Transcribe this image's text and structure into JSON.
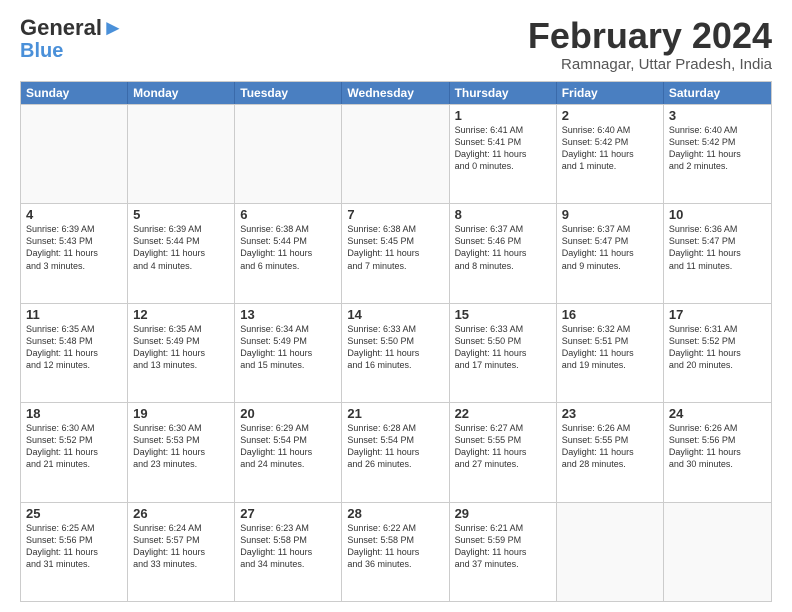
{
  "logo": {
    "line1": "General",
    "line2": "Blue"
  },
  "title": "February 2024",
  "subtitle": "Ramnagar, Uttar Pradesh, India",
  "days": [
    "Sunday",
    "Monday",
    "Tuesday",
    "Wednesday",
    "Thursday",
    "Friday",
    "Saturday"
  ],
  "rows": [
    [
      {
        "day": "",
        "info": ""
      },
      {
        "day": "",
        "info": ""
      },
      {
        "day": "",
        "info": ""
      },
      {
        "day": "",
        "info": ""
      },
      {
        "day": "1",
        "info": "Sunrise: 6:41 AM\nSunset: 5:41 PM\nDaylight: 11 hours\nand 0 minutes."
      },
      {
        "day": "2",
        "info": "Sunrise: 6:40 AM\nSunset: 5:42 PM\nDaylight: 11 hours\nand 1 minute."
      },
      {
        "day": "3",
        "info": "Sunrise: 6:40 AM\nSunset: 5:42 PM\nDaylight: 11 hours\nand 2 minutes."
      }
    ],
    [
      {
        "day": "4",
        "info": "Sunrise: 6:39 AM\nSunset: 5:43 PM\nDaylight: 11 hours\nand 3 minutes."
      },
      {
        "day": "5",
        "info": "Sunrise: 6:39 AM\nSunset: 5:44 PM\nDaylight: 11 hours\nand 4 minutes."
      },
      {
        "day": "6",
        "info": "Sunrise: 6:38 AM\nSunset: 5:44 PM\nDaylight: 11 hours\nand 6 minutes."
      },
      {
        "day": "7",
        "info": "Sunrise: 6:38 AM\nSunset: 5:45 PM\nDaylight: 11 hours\nand 7 minutes."
      },
      {
        "day": "8",
        "info": "Sunrise: 6:37 AM\nSunset: 5:46 PM\nDaylight: 11 hours\nand 8 minutes."
      },
      {
        "day": "9",
        "info": "Sunrise: 6:37 AM\nSunset: 5:47 PM\nDaylight: 11 hours\nand 9 minutes."
      },
      {
        "day": "10",
        "info": "Sunrise: 6:36 AM\nSunset: 5:47 PM\nDaylight: 11 hours\nand 11 minutes."
      }
    ],
    [
      {
        "day": "11",
        "info": "Sunrise: 6:35 AM\nSunset: 5:48 PM\nDaylight: 11 hours\nand 12 minutes."
      },
      {
        "day": "12",
        "info": "Sunrise: 6:35 AM\nSunset: 5:49 PM\nDaylight: 11 hours\nand 13 minutes."
      },
      {
        "day": "13",
        "info": "Sunrise: 6:34 AM\nSunset: 5:49 PM\nDaylight: 11 hours\nand 15 minutes."
      },
      {
        "day": "14",
        "info": "Sunrise: 6:33 AM\nSunset: 5:50 PM\nDaylight: 11 hours\nand 16 minutes."
      },
      {
        "day": "15",
        "info": "Sunrise: 6:33 AM\nSunset: 5:50 PM\nDaylight: 11 hours\nand 17 minutes."
      },
      {
        "day": "16",
        "info": "Sunrise: 6:32 AM\nSunset: 5:51 PM\nDaylight: 11 hours\nand 19 minutes."
      },
      {
        "day": "17",
        "info": "Sunrise: 6:31 AM\nSunset: 5:52 PM\nDaylight: 11 hours\nand 20 minutes."
      }
    ],
    [
      {
        "day": "18",
        "info": "Sunrise: 6:30 AM\nSunset: 5:52 PM\nDaylight: 11 hours\nand 21 minutes."
      },
      {
        "day": "19",
        "info": "Sunrise: 6:30 AM\nSunset: 5:53 PM\nDaylight: 11 hours\nand 23 minutes."
      },
      {
        "day": "20",
        "info": "Sunrise: 6:29 AM\nSunset: 5:54 PM\nDaylight: 11 hours\nand 24 minutes."
      },
      {
        "day": "21",
        "info": "Sunrise: 6:28 AM\nSunset: 5:54 PM\nDaylight: 11 hours\nand 26 minutes."
      },
      {
        "day": "22",
        "info": "Sunrise: 6:27 AM\nSunset: 5:55 PM\nDaylight: 11 hours\nand 27 minutes."
      },
      {
        "day": "23",
        "info": "Sunrise: 6:26 AM\nSunset: 5:55 PM\nDaylight: 11 hours\nand 28 minutes."
      },
      {
        "day": "24",
        "info": "Sunrise: 6:26 AM\nSunset: 5:56 PM\nDaylight: 11 hours\nand 30 minutes."
      }
    ],
    [
      {
        "day": "25",
        "info": "Sunrise: 6:25 AM\nSunset: 5:56 PM\nDaylight: 11 hours\nand 31 minutes."
      },
      {
        "day": "26",
        "info": "Sunrise: 6:24 AM\nSunset: 5:57 PM\nDaylight: 11 hours\nand 33 minutes."
      },
      {
        "day": "27",
        "info": "Sunrise: 6:23 AM\nSunset: 5:58 PM\nDaylight: 11 hours\nand 34 minutes."
      },
      {
        "day": "28",
        "info": "Sunrise: 6:22 AM\nSunset: 5:58 PM\nDaylight: 11 hours\nand 36 minutes."
      },
      {
        "day": "29",
        "info": "Sunrise: 6:21 AM\nSunset: 5:59 PM\nDaylight: 11 hours\nand 37 minutes."
      },
      {
        "day": "",
        "info": ""
      },
      {
        "day": "",
        "info": ""
      }
    ]
  ]
}
